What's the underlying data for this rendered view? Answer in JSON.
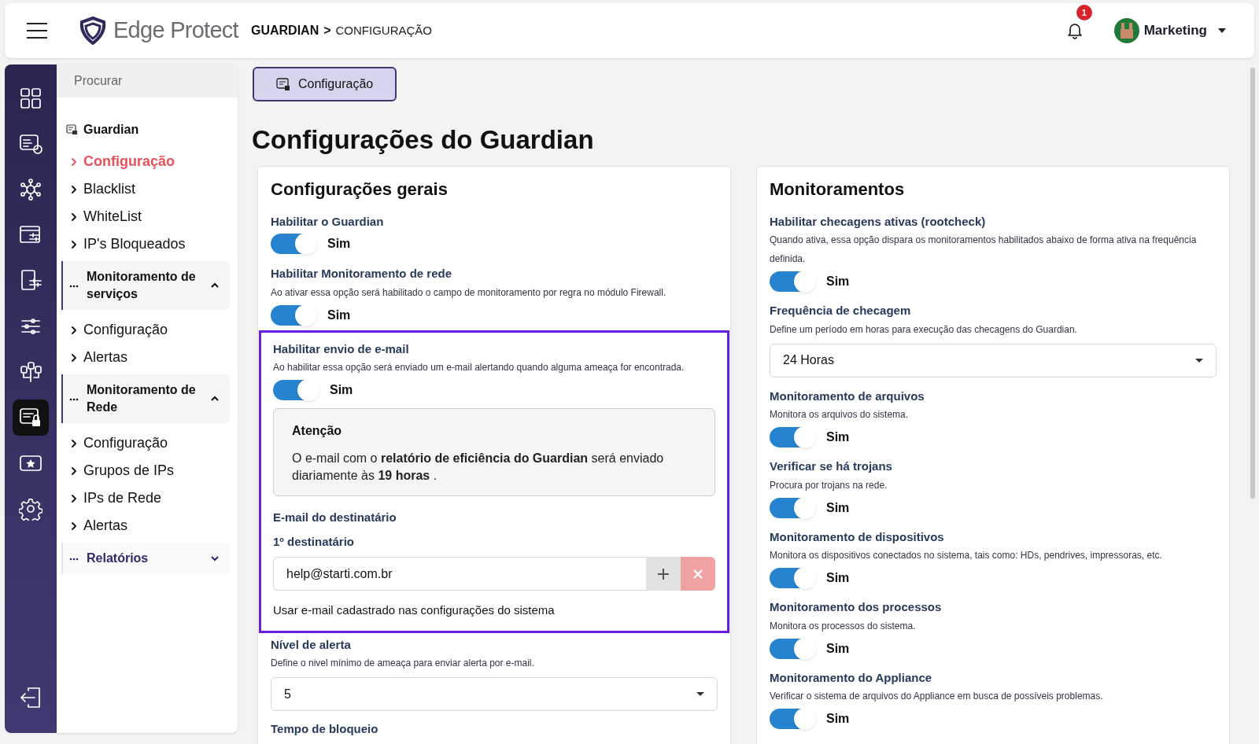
{
  "header": {
    "logo": "Edge Protect",
    "breadcrumb": {
      "parent": "GUARDIAN",
      "separator": ">",
      "current": "CONFIGURAÇÃO"
    },
    "notifications": {
      "count": "1"
    },
    "user": {
      "name": "Marketing"
    }
  },
  "rail": {
    "items": [
      {
        "selected": false
      },
      {
        "selected": false
      },
      {
        "selected": false
      },
      {
        "selected": false
      },
      {
        "selected": false
      },
      {
        "selected": false
      },
      {
        "selected": false
      },
      {
        "selected": true
      },
      {
        "selected": false
      },
      {
        "selected": false
      }
    ]
  },
  "sidebar": {
    "search": {
      "placeholder": "Procurar"
    },
    "module": {
      "label": "Guardian",
      "children": [
        {
          "label": "Configuração",
          "selected": true
        },
        {
          "label": "Blacklist",
          "selected": false
        },
        {
          "label": "WhiteList",
          "selected": false
        },
        {
          "label": "IP's Bloqueados",
          "selected": false
        }
      ]
    },
    "groups": [
      {
        "label": "Monitoramento de serviços",
        "expanded": true,
        "children": [
          {
            "label": "Configuração",
            "selected": false
          },
          {
            "label": "Alertas",
            "selected": false
          }
        ]
      },
      {
        "label": "Monitoramento de Rede",
        "expanded": true,
        "children": [
          {
            "label": "Configuração",
            "selected": false
          },
          {
            "label": "Grupos de IPs",
            "selected": false
          },
          {
            "label": "IPs de Rede",
            "selected": false
          },
          {
            "label": "Alertas",
            "selected": false
          }
        ]
      },
      {
        "label": "Relatórios",
        "expanded": false
      }
    ]
  },
  "page_tab": {
    "label": "Configuração"
  },
  "page_title": "Configurações do Guardian",
  "general": {
    "title": "Configurações gerais",
    "fields": [
      {
        "kind": "toggle",
        "label": "Habilitar o Guardian",
        "on": true,
        "value": "Sim"
      },
      {
        "kind": "toggle",
        "label": "Habilitar Monitoramento de rede",
        "description": "Ao ativar essa opção será habilitado o campo de monitoramento por regra no módulo Firewall.",
        "on": true,
        "value": "Sim"
      }
    ],
    "email": {
      "highlighted": true,
      "label": "Habilitar envio de e-mail",
      "description": "Ao habilitar essa opção será enviado um e-mail alertando quando alguma ameaça for encontrada.",
      "on": true,
      "value": "Sim",
      "notice": {
        "title": "Atenção",
        "text": "O e-mail com o **relatório de eficiência do Guardian** será enviado diariamente às **19 horas** ."
      },
      "recipients_label": "E-mail do destinatário",
      "recipients": [
        {
          "label": "1º destinatário",
          "value": "help@starti.com.br"
        }
      ],
      "system_email_label": "Usar e-mail cadastrado nas configurações do sistema"
    },
    "after": [
      {
        "kind": "select",
        "label": "Nível de alerta",
        "description": "Define o nivel mínimo de ameaça para enviar alerta por e-mail.",
        "value": "5"
      },
      {
        "kind": "heading",
        "label": "Tempo de bloqueio"
      }
    ]
  },
  "monitoring": {
    "title": "Monitoramentos",
    "fields": [
      {
        "kind": "toggle",
        "label": "Habilitar checagens ativas (rootcheck)",
        "description": "Quando ativa, essa opção dispara os monitoramentos habilitados abaixo de forma ativa na frequência definida.",
        "on": true,
        "value": "Sim"
      },
      {
        "kind": "select",
        "label": "Frequência de checagem",
        "description": "Define um período em horas para execução das checagens do Guardian.",
        "value": "24 Horas"
      },
      {
        "kind": "toggle",
        "label": "Monitoramento de arquivos",
        "description": "Monitora os arquivos do sistema.",
        "on": true,
        "value": "Sim"
      },
      {
        "kind": "toggle",
        "label": "Verificar se há trojans",
        "description": "Procura por trojans na rede.",
        "on": true,
        "value": "Sim"
      },
      {
        "kind": "toggle",
        "label": "Monitoramento de dispositivos",
        "description": "Monitora os dispositivos conectados no sistema, tais como: HDs, pendrives, impressoras, etc.",
        "on": true,
        "value": "Sim"
      },
      {
        "kind": "toggle",
        "label": "Monitoramento dos processos",
        "description": "Monitora os processos do sistema.",
        "on": true,
        "value": "Sim"
      },
      {
        "kind": "toggle",
        "label": "Monitoramento do Appliance",
        "description": "Verificar o sistema de arquivos do Appliance em busca de possíveis problemas.",
        "on": true,
        "value": "Sim"
      }
    ]
  }
}
